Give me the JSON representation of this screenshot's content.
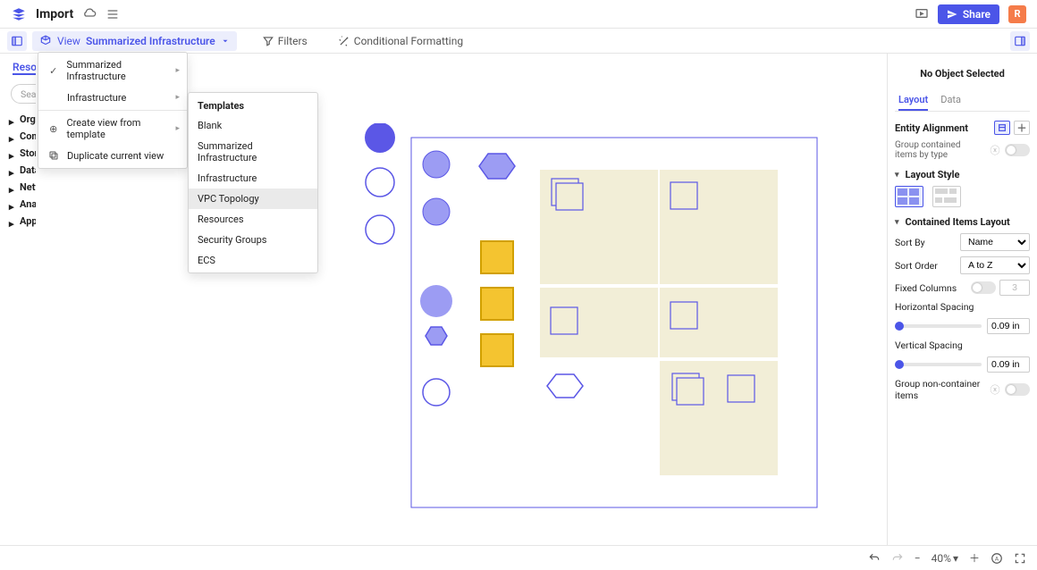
{
  "topbar": {
    "title": "Import",
    "share_label": "Share",
    "avatar_letter": "R"
  },
  "toolbar": {
    "view_label": "View",
    "view_current": "Summarized Infrastructure",
    "filters_label": "Filters",
    "cond_fmt_label": "Conditional Formatting"
  },
  "sidebar": {
    "tab_resources": "Resources",
    "search_placeholder": "Search Resources",
    "tree": [
      "Organization",
      "Compute",
      "Storage",
      "Database",
      "Networking & Content Delivery",
      "Analytics",
      "Application Integration"
    ]
  },
  "view_menu": {
    "items": [
      {
        "label": "Summarized Infrastructure",
        "icon": "check",
        "submenu": true
      },
      {
        "label": "Infrastructure",
        "icon": "",
        "submenu": true
      }
    ],
    "sep_after": 2,
    "more": [
      {
        "label": "Create view from template",
        "icon": "plus",
        "submenu": true
      },
      {
        "label": "Duplicate current view",
        "icon": "copy",
        "submenu": false
      }
    ]
  },
  "templates_menu": {
    "header": "Templates",
    "items": [
      "Blank",
      "Summarized Infrastructure",
      "Infrastructure",
      "VPC Topology",
      "Resources",
      "Security Groups",
      "ECS"
    ],
    "highlighted": "VPC Topology"
  },
  "rightpanel": {
    "title": "No Object Selected",
    "tab_layout": "Layout",
    "tab_data": "Data",
    "entity_alignment": "Entity Alignment",
    "group_contained": "Group contained items by type",
    "layout_style": "Layout Style",
    "contained_layout": "Contained Items Layout",
    "sort_by_label": "Sort By",
    "sort_by_value": "Name",
    "sort_order_label": "Sort Order",
    "sort_order_value": "A to Z",
    "fixed_columns_label": "Fixed Columns",
    "fixed_columns_value": "3",
    "h_spacing_label": "Horizontal Spacing",
    "h_spacing_value": "0.09 in",
    "v_spacing_label": "Vertical Spacing",
    "v_spacing_value": "0.09 in",
    "group_noncontainer": "Group non-container items"
  },
  "bottombar": {
    "zoom": "40%"
  }
}
